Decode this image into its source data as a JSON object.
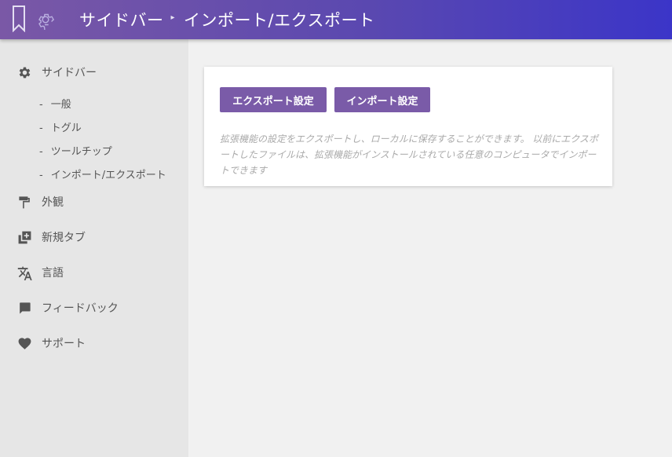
{
  "header": {
    "bookmark_icon": "bookmark-icon",
    "gear_icon": "gear-icon",
    "breadcrumb": [
      "サイドバー",
      "インポート/エクスポート"
    ],
    "breadcrumb_separator": "▸",
    "gradient_colors": [
      "#7a58a6",
      "#3b35c8"
    ]
  },
  "sidebar": {
    "items": [
      {
        "label": "サイドバー",
        "icon": "gear-icon"
      },
      {
        "label": "外観",
        "icon": "paint-roller-icon"
      },
      {
        "label": "新規タブ",
        "icon": "add-tab-icon"
      },
      {
        "label": "言語",
        "icon": "translate-icon"
      },
      {
        "label": "フィードバック",
        "icon": "chat-icon"
      },
      {
        "label": "サポート",
        "icon": "heart-icon"
      }
    ],
    "subitems": [
      {
        "label": "一般"
      },
      {
        "label": "トグル"
      },
      {
        "label": "ツールチップ"
      },
      {
        "label": "インポート/エクスポート"
      }
    ],
    "sub_dash": "-"
  },
  "main": {
    "export_button": "エクスポート設定",
    "import_button": "インポート設定",
    "description": "拡張機能の設定をエクスポートし、ローカルに保存することができます。 以前にエクスポートしたファイルは、拡張機能がインストールされている任意のコンピュータでインポートできます",
    "accent_color": "#7a5ba8"
  }
}
